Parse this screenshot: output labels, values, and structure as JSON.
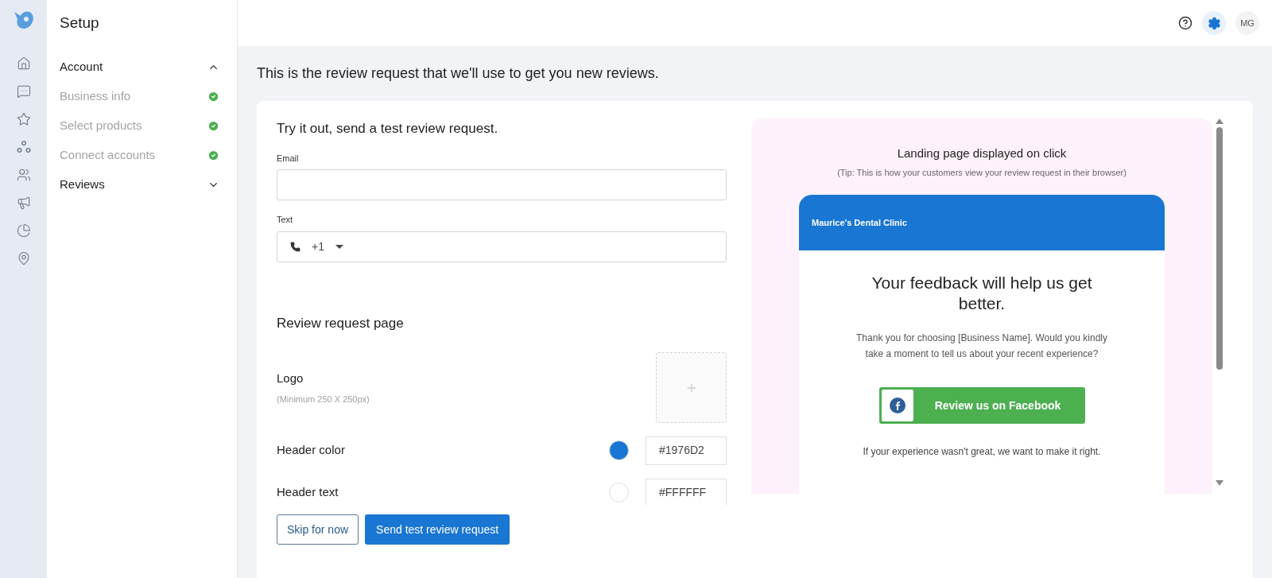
{
  "sidebar": {
    "title": "Setup",
    "sections": [
      {
        "label": "Account",
        "expanded": true,
        "children": [
          {
            "label": "Business info",
            "done": true
          },
          {
            "label": "Select products",
            "done": true
          },
          {
            "label": "Connect accounts",
            "done": true
          }
        ]
      },
      {
        "label": "Reviews",
        "expanded": false
      }
    ]
  },
  "header": {
    "avatar": "MG"
  },
  "intro": "This is the review request that we'll use to get you new reviews.",
  "test_form": {
    "title": "Try it out, send a test review request.",
    "email_label": "Email",
    "text_label": "Text",
    "country_code": "+1"
  },
  "page_settings": {
    "title": "Review request page",
    "logo_label": "Logo",
    "logo_hint": "(Minimum 250 X 250px)",
    "colors": [
      {
        "label": "Header color",
        "value": "#1976D2",
        "color": "#1976d2"
      },
      {
        "label": "Header text",
        "value": "#FFFFFF",
        "color": "#ffffff"
      }
    ]
  },
  "buttons": [
    {
      "label": "Skip for now",
      "kind": "secondary"
    },
    {
      "label": "Send test review request",
      "kind": "primary"
    }
  ],
  "preview": {
    "title": "Landing page displayed on click",
    "tip": "(Tip: This is how your customers view your review request in their browser)",
    "business": "Maurice's Dental Clinic",
    "heading": "Your feedback will help us get better.",
    "message": "Thank you for choosing [Business Name]. Would you kindly take a moment to tell us about your recent experience?",
    "review_button": "Review us on Facebook",
    "footer": "If your experience wasn't great, we want to make it right."
  }
}
